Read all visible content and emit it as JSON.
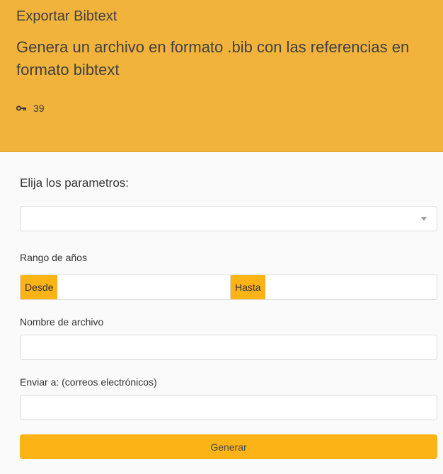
{
  "header": {
    "title": "Exportar Bibtext",
    "description": "Genera un archivo en formato .bib con las referencias en formato bibtext",
    "key_icon": "key-icon",
    "count": "39",
    "background_color": "#f1b33c"
  },
  "form": {
    "params_label": "Elija los parametros:",
    "select": {
      "value": "",
      "caret_icon": "chevron-down-icon"
    },
    "year_range": {
      "label": "Rango de años",
      "from_label": "Desde",
      "from_value": "",
      "to_label": "Hasta",
      "to_value": ""
    },
    "filename": {
      "label": "Nombre de archivo",
      "value": ""
    },
    "send_to": {
      "label": "Enviar a: (correos electrónicos)",
      "value": ""
    },
    "submit_label": "Generar",
    "accent_color": "#fbb316"
  }
}
